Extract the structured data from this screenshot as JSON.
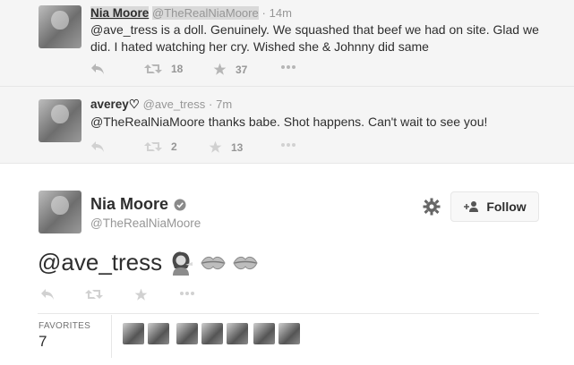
{
  "replies": [
    {
      "name": "Nia Moore",
      "handle": "@TheRealNiaMoore",
      "dot": "·",
      "time": "14m",
      "text_line1": "@ave_tress is a doll. Genuinely. We squashed that beef we had on site. Glad we",
      "text_line2": "did. I hated watching her cry. Wished she & Johnny did same",
      "retweets": "18",
      "favorites": "37"
    },
    {
      "name": "averey♡",
      "handle": "@ave_tress",
      "dot": "·",
      "time": "7m",
      "text_line1": "@TheRealNiaMoore thanks babe. Shot happens. Can't wait to see you!",
      "retweets": "2",
      "favorites": "13"
    }
  ],
  "main": {
    "name": "Nia Moore",
    "handle": "@TheRealNiaMoore",
    "follow_label": "Follow",
    "text": "@ave_tress",
    "favorites_label": "FAVORITES",
    "favorites_count": "7"
  },
  "icons": [
    "reply-icon",
    "retweet-icon",
    "favorite-icon",
    "more-icon",
    "verified-icon",
    "gear-icon",
    "follow-person-icon",
    "kiss-icon"
  ]
}
